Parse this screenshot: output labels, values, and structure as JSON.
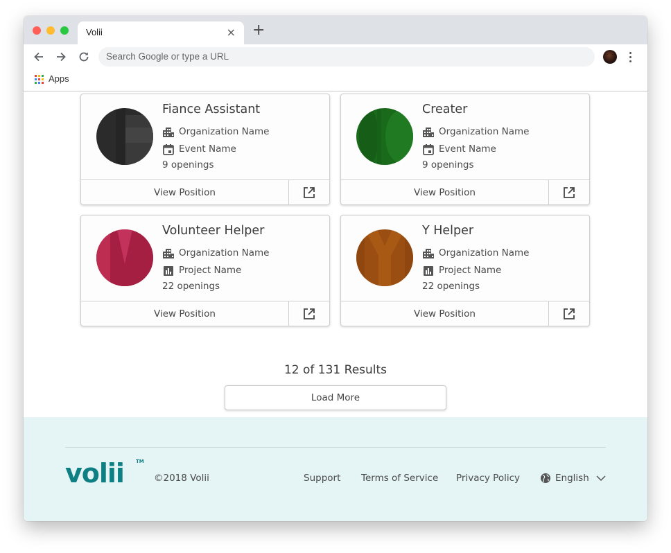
{
  "browser": {
    "tab_title": "Volii",
    "tab_close": "×",
    "new_tab": "+",
    "omnibox_placeholder": "Search Google or type a URL",
    "bookmark_apps": "Apps"
  },
  "cards": [
    {
      "title": "Fiance Assistant",
      "org": "Organization Name",
      "second": "Event Name",
      "second_icon": "calendar-icon",
      "openings": "9 openings",
      "view": "View Position",
      "image_color": "#2b2b2b"
    },
    {
      "title": "Creater",
      "org": "Organization Name",
      "second": "Event Name",
      "second_icon": "calendar-icon",
      "openings": "9 openings",
      "view": "View Position",
      "image_color": "#1a6a1c"
    },
    {
      "title": "Volunteer Helper",
      "org": "Organization Name",
      "second": "Project Name",
      "second_icon": "chart-icon",
      "openings": "22 openings",
      "view": "View Position",
      "image_color": "#b4244a"
    },
    {
      "title": "Y Helper",
      "org": "Organization Name",
      "second": "Project Name",
      "second_icon": "chart-icon",
      "openings": "22 openings",
      "view": "View Position",
      "image_color": "#9a4e12"
    }
  ],
  "results_text": "12 of 131 Results",
  "load_more": "Load More",
  "footer": {
    "logo": "volii",
    "trademark": "TM",
    "copyright": "©2018 Volii",
    "links": [
      "Support",
      "Terms of Service",
      "Privacy Policy"
    ],
    "language": "English"
  },
  "colors": {
    "brand_teal": "#0e7f83",
    "footer_bg": "#e5f4f5"
  }
}
